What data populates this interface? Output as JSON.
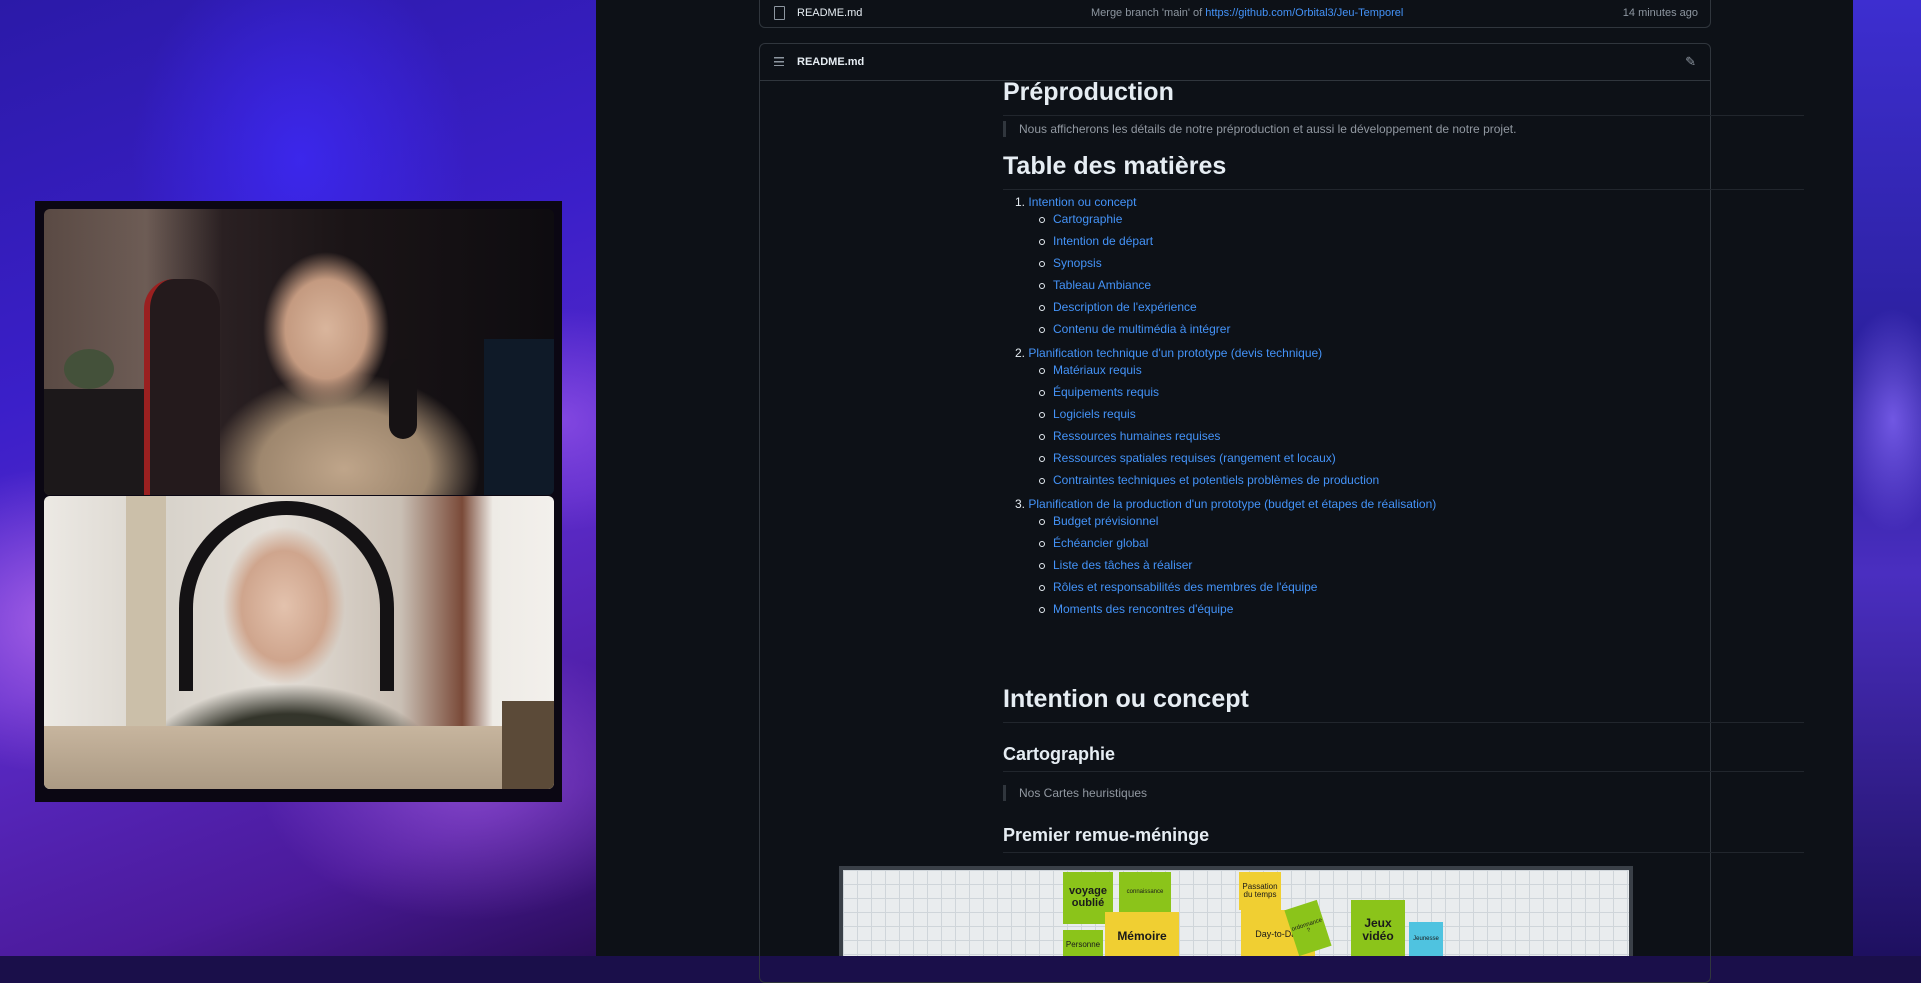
{
  "file_row": {
    "filename": "README.md",
    "commit_prefix": "Merge branch 'main' of ",
    "commit_link": "https://github.com/Orbital3/Jeu-Temporel",
    "time": "14 minutes ago"
  },
  "readme": {
    "header_title": "README.md",
    "pencil_glyph": "✎",
    "h_preproduction": "Préproduction",
    "intro_quote": "Nous afficherons les détails de notre préproduction et aussi le développement de notre projet.",
    "h_toc": "Table des matières",
    "toc": [
      {
        "num": "1.",
        "label": "Intention ou concept",
        "children": [
          "Cartographie",
          "Intention de départ",
          "Synopsis",
          "Tableau Ambiance",
          "Description de l'expérience",
          "Contenu de multimédia à intégrer"
        ]
      },
      {
        "num": "2.",
        "label": "Planification technique d'un prototype (devis technique)",
        "children": [
          "Matériaux requis",
          "Équipements requis",
          "Logiciels requis",
          "Ressources humaines requises",
          "Ressources spatiales requises (rangement et locaux)",
          "Contraintes techniques et potentiels problèmes de production"
        ]
      },
      {
        "num": "3.",
        "label": "Planification de la production d'un prototype (budget et étapes de réalisation)",
        "children": [
          "Budget prévisionnel",
          "Échéancier global",
          "Liste des tâches à réaliser",
          "Rôles et responsabilités des membres de l'équipe",
          "Moments des rencontres d'équipe"
        ]
      }
    ],
    "h_intention": "Intention ou concept",
    "h_cartographie": "Cartographie",
    "carto_quote": "Nos Cartes heuristiques",
    "h_remue": "Premier remue-méninge"
  },
  "mindmap_notes": {
    "voyage": "voyage oublié",
    "connaissance": "connaissance",
    "passation": "Passation du temps",
    "jeux": "Jeux vidéo",
    "jeunesse": "Jeunesse",
    "memoire": "Mémoire",
    "day": "Day-to-Day",
    "personne": "Personne",
    "tiny": "ordonnance ?"
  },
  "colors": {
    "gh_bg": "#0d1117",
    "border": "#30363d",
    "link": "#4493f8",
    "text": "#e6edf3",
    "muted": "#9198a1",
    "sticky_green": "#8bc41a",
    "sticky_yellow": "#f0cf32",
    "sticky_cyan": "#4fc3e0"
  }
}
